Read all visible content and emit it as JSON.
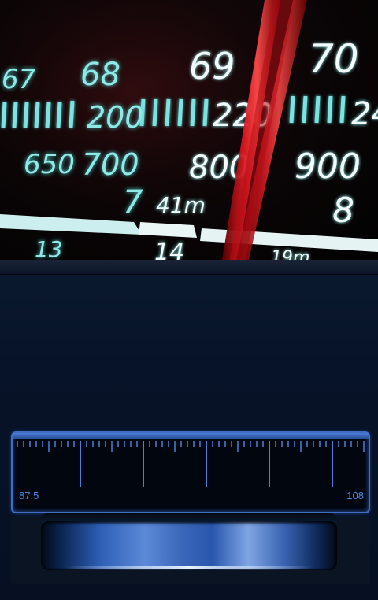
{
  "photo_dial": {
    "row1_numbers": [
      "67",
      "68",
      "69",
      "70"
    ],
    "row2_numbers": [
      "200",
      "220",
      "24"
    ],
    "row3_numbers": [
      "650",
      "700",
      "800",
      "900"
    ],
    "row4_numbers": [
      "7",
      "41m",
      "8"
    ],
    "row5_numbers": [
      "13",
      "14",
      "19m"
    ]
  },
  "tuner": {
    "min_label": "87.5",
    "max_label": "108"
  },
  "colors": {
    "accent_blue": "#3f6ec4",
    "dial_cyan": "#8fe9e6",
    "needle_red": "#d8141e"
  }
}
